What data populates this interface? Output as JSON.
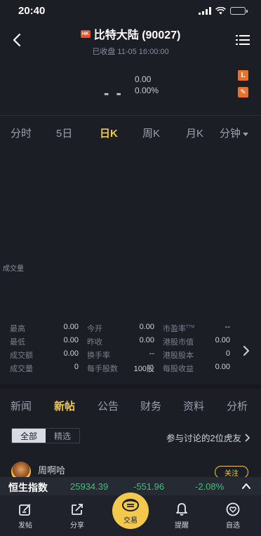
{
  "status": {
    "time": "20:40"
  },
  "header": {
    "badge": "HK",
    "title": "比特大陆 (90027)",
    "subtitle": "已收盘 11-05 16:00:00"
  },
  "quote": {
    "price": "- -",
    "change": "0.00",
    "change_pct": "0.00%",
    "side_icon_1": "L",
    "side_icon_2": "✎"
  },
  "period_tabs": [
    {
      "label": "分时"
    },
    {
      "label": "5日"
    },
    {
      "label": "日K"
    },
    {
      "label": "周K"
    },
    {
      "label": "月K"
    },
    {
      "label": "分钟"
    }
  ],
  "chart": {
    "volume_label": "成交量"
  },
  "stats": [
    [
      {
        "label": "最高",
        "value": "0.00"
      },
      {
        "label": "今开",
        "value": "0.00"
      },
      {
        "label": "市盈率",
        "sup": "TTM",
        "value": "--"
      }
    ],
    [
      {
        "label": "最低",
        "value": "0.00"
      },
      {
        "label": "昨收",
        "value": "0.00"
      },
      {
        "label": "港股市值",
        "value": "0.00"
      }
    ],
    [
      {
        "label": "成交额",
        "value": "0.00"
      },
      {
        "label": "换手率",
        "value": "--"
      },
      {
        "label": "港股股本",
        "value": "0"
      }
    ],
    [
      {
        "label": "成交量",
        "value": "0"
      },
      {
        "label": "每手股数",
        "value": "100股"
      },
      {
        "label": "每股收益",
        "value": "0.00"
      }
    ]
  ],
  "news_tabs": [
    {
      "label": "新闻"
    },
    {
      "label": "新帖"
    },
    {
      "label": "公告"
    },
    {
      "label": "财务"
    },
    {
      "label": "资料"
    },
    {
      "label": "分析"
    }
  ],
  "filter": {
    "segments": [
      {
        "label": "全部"
      },
      {
        "label": "精选"
      }
    ],
    "discuss": "参与讨论的2位虎友"
  },
  "post": {
    "user": "周啊哈",
    "follow": "关注"
  },
  "ticker": {
    "name": "恒生指数",
    "value": "25934.39",
    "change": "-551.96",
    "change_pct": "-2.08%",
    "change_color": "#3ec27a"
  },
  "bottom_nav": [
    {
      "label": "发帖",
      "icon": "post-icon"
    },
    {
      "label": "分享",
      "icon": "share-icon"
    },
    {
      "label": "交易",
      "icon": "trade-icon"
    },
    {
      "label": "提醒",
      "icon": "bell-icon"
    },
    {
      "label": "自选",
      "icon": "heart-icon"
    }
  ]
}
